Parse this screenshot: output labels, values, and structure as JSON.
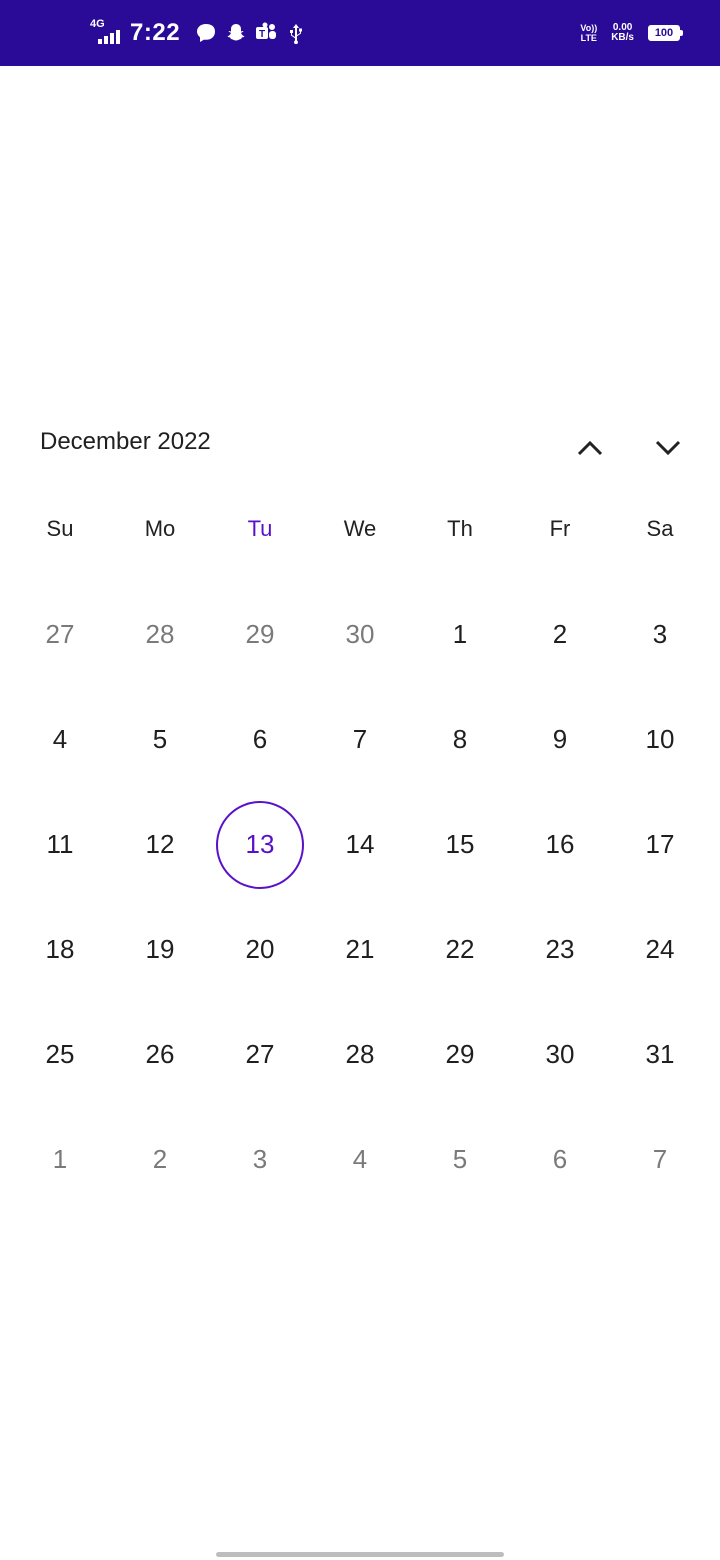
{
  "status_bar": {
    "network": "4G",
    "time": "7:22",
    "volte_top": "Vo))",
    "volte_bottom": "LTE",
    "speed_value": "0.00",
    "speed_unit": "KB/s",
    "battery": "100",
    "icons": [
      "signal-icon",
      "message-icon",
      "snapchat-icon",
      "teams-icon",
      "usb-icon"
    ]
  },
  "calendar": {
    "month_label": "December 2022",
    "weekdays": [
      "Su",
      "Mo",
      "Tu",
      "We",
      "Th",
      "Fr",
      "Sa"
    ],
    "today_weekday_index": 2,
    "selected_day": "13",
    "accent_color": "#5a10c8",
    "weeks": [
      [
        {
          "d": "27",
          "m": true
        },
        {
          "d": "28",
          "m": true
        },
        {
          "d": "29",
          "m": true
        },
        {
          "d": "30",
          "m": true
        },
        {
          "d": "1"
        },
        {
          "d": "2"
        },
        {
          "d": "3"
        }
      ],
      [
        {
          "d": "4"
        },
        {
          "d": "5"
        },
        {
          "d": "6"
        },
        {
          "d": "7"
        },
        {
          "d": "8"
        },
        {
          "d": "9"
        },
        {
          "d": "10"
        }
      ],
      [
        {
          "d": "11"
        },
        {
          "d": "12"
        },
        {
          "d": "13",
          "t": true
        },
        {
          "d": "14"
        },
        {
          "d": "15"
        },
        {
          "d": "16"
        },
        {
          "d": "17"
        }
      ],
      [
        {
          "d": "18"
        },
        {
          "d": "19"
        },
        {
          "d": "20"
        },
        {
          "d": "21"
        },
        {
          "d": "22"
        },
        {
          "d": "23"
        },
        {
          "d": "24"
        }
      ],
      [
        {
          "d": "25"
        },
        {
          "d": "26"
        },
        {
          "d": "27"
        },
        {
          "d": "28"
        },
        {
          "d": "29"
        },
        {
          "d": "30"
        },
        {
          "d": "31"
        }
      ],
      [
        {
          "d": "1",
          "m": true
        },
        {
          "d": "2",
          "m": true
        },
        {
          "d": "3",
          "m": true
        },
        {
          "d": "4",
          "m": true
        },
        {
          "d": "5",
          "m": true
        },
        {
          "d": "6",
          "m": true
        },
        {
          "d": "7",
          "m": true
        }
      ]
    ]
  },
  "theme": {
    "status_bar_color": "#2a0b98"
  }
}
